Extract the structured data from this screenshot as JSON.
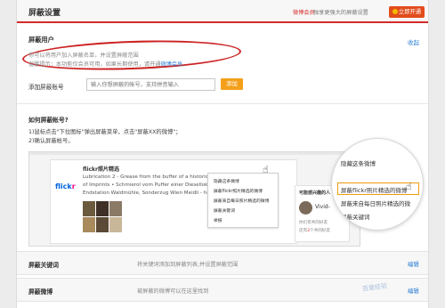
{
  "header": {
    "title": "屏蔽设置",
    "vip_label": "微博会员",
    "vip_desc": "独享更强大的屏蔽设置",
    "open_button": "立即开通"
  },
  "block_user": {
    "title": "屏蔽用户",
    "collapse": "收起",
    "desc1": "你可以将用户加入屏蔽名单，并设置屏蔽范围",
    "desc2_prefix": "温馨提示：本功能仅会员可用，如果长期使用，请开通",
    "desc2_link": "微博会员",
    "desc2_suffix": "。",
    "input_label": "添加屏蔽账号",
    "input_placeholder": "输入你想屏蔽的帐号，支持拼音输入",
    "add_button": "添加"
  },
  "howto": {
    "title": "如何屏蔽帐号?",
    "step1": "1)鼠标点击\"下拉图标\"弹出屏蔽菜单，点击\"屏蔽XX的微博\"；",
    "step2": "2)确认屏蔽帐号。"
  },
  "example": {
    "user": "flickr照片精选",
    "post_lines": [
      "Lubrication 2 - Grease from the buffer of a historic ...",
      "of Imprints • Schmierol vom Puffer einer Diesellok",
      "Endstation Waldmühle, Sonderzug Wien Meidli - hea..."
    ],
    "brand1": "flick",
    "brand2": "r",
    "menu_items": [
      "隐藏这条微博",
      "屏蔽flickr照片精选的微博",
      "屏蔽来自每日照片精选的微博",
      "屏蔽关键词",
      "举报"
    ],
    "side_title": "可能感兴趣的人",
    "side_name": "Vivid-",
    "side_line1": "你们有共同好友",
    "side_line2_prefix": "还有",
    "side_line2_count": "2",
    "side_line2_suffix": "个共同好友",
    "zoom_items": [
      "隐藏这条微博",
      "屏蔽flickr照片精选的微博",
      "屏蔽来自每日照片精选的微",
      "屏蔽关键词"
    ]
  },
  "rows": [
    {
      "title": "屏蔽关键词",
      "desc": "将关键词添加到屏蔽列表,并设置屏蔽范围",
      "edit": "编辑"
    },
    {
      "title": "屏蔽微博",
      "desc": "被屏蔽的微博可以在这里找到",
      "edit": "编辑"
    }
  ],
  "watermark": "百度经验",
  "colors": {
    "accent_red": "#d32b2b",
    "link_blue": "#2c7fd6",
    "add_orange": "#f4a01b",
    "open_button": "#e24c1c"
  }
}
